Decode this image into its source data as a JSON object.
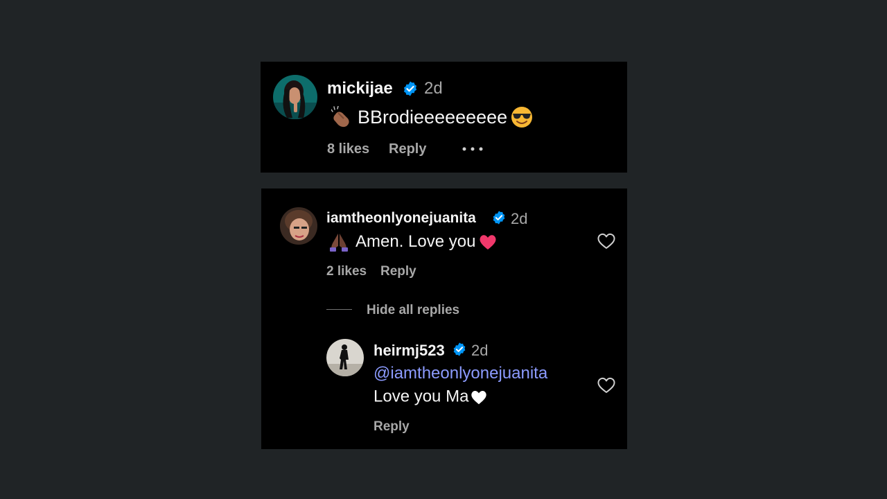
{
  "comments": [
    {
      "username": "mickijae",
      "time": "2d",
      "text": "BBrodieeeeeeeee",
      "likes": "8 likes",
      "reply_label": "Reply",
      "emojis": [
        "clapping-hands",
        "smiling-face-with-sunglasses"
      ]
    },
    {
      "username": "iamtheonlyonejuanita",
      "time": "2d",
      "text": "Amen. Love you",
      "likes": "2 likes",
      "reply_label": "Reply",
      "emojis": [
        "folded-hands",
        "pink-heart"
      ],
      "hide_replies_label": "Hide all replies",
      "replies": [
        {
          "username": "heirmj523",
          "time": "2d",
          "mention": "@iamtheonlyonejuanita",
          "text": "Love you Ma",
          "reply_label": "Reply",
          "emojis": [
            "white-heart"
          ]
        }
      ]
    }
  ],
  "colors": {
    "page_background": "#202426",
    "card_background": "#000000",
    "text_primary": "#f5f5f5",
    "text_secondary": "#a8a8a8",
    "verified_badge": "#0095f6",
    "mention": "#8c9bff"
  }
}
